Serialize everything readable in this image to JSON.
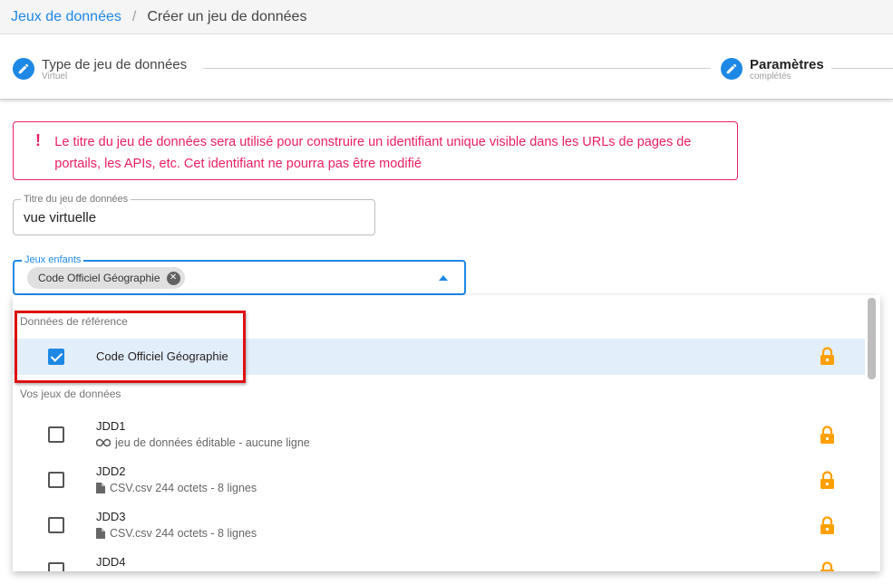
{
  "breadcrumb": {
    "link": "Jeux de données",
    "separator": "/",
    "current": "Créer un jeu de données"
  },
  "stepper": {
    "step1": {
      "title": "Type de jeu de données",
      "subtitle": "Virtuel",
      "icon": "pencil-icon"
    },
    "step2": {
      "title": "Paramètres",
      "subtitle": "complétés",
      "icon": "pencil-icon"
    }
  },
  "alert": {
    "icon": "!",
    "text": "Le titre du jeu de données sera utilisé pour construire un identifiant unique visible dans les URLs de pages de portails, les APIs, etc. Cet identifiant ne pourra pas être modifié"
  },
  "title_field": {
    "label": "Titre du jeu de données",
    "value": "vue virtuelle"
  },
  "children_field": {
    "label": "Jeux enfants",
    "chip": "Code Officiel Géographie"
  },
  "menu": {
    "section_ref": "Données de référence",
    "ref_item": {
      "title": "Code Officiel Géographie",
      "checked": true
    },
    "section_mine": "Vos jeux de données",
    "items": [
      {
        "title": "JDD1",
        "subtitle": "jeu de données éditable - aucune ligne",
        "icon": "infinity-icon"
      },
      {
        "title": "JDD2",
        "subtitle": "CSV.csv 244 octets - 8 lignes",
        "icon": "file-icon"
      },
      {
        "title": "JDD3",
        "subtitle": "CSV.csv 244 octets - 8 lignes",
        "icon": "file-icon"
      },
      {
        "title": "JDD4",
        "subtitle": "",
        "icon": "file-icon"
      }
    ]
  },
  "colors": {
    "primary": "#1e88e5",
    "alert": "#e91e63",
    "lock": "#ffa000",
    "highlight": "#e01010"
  }
}
